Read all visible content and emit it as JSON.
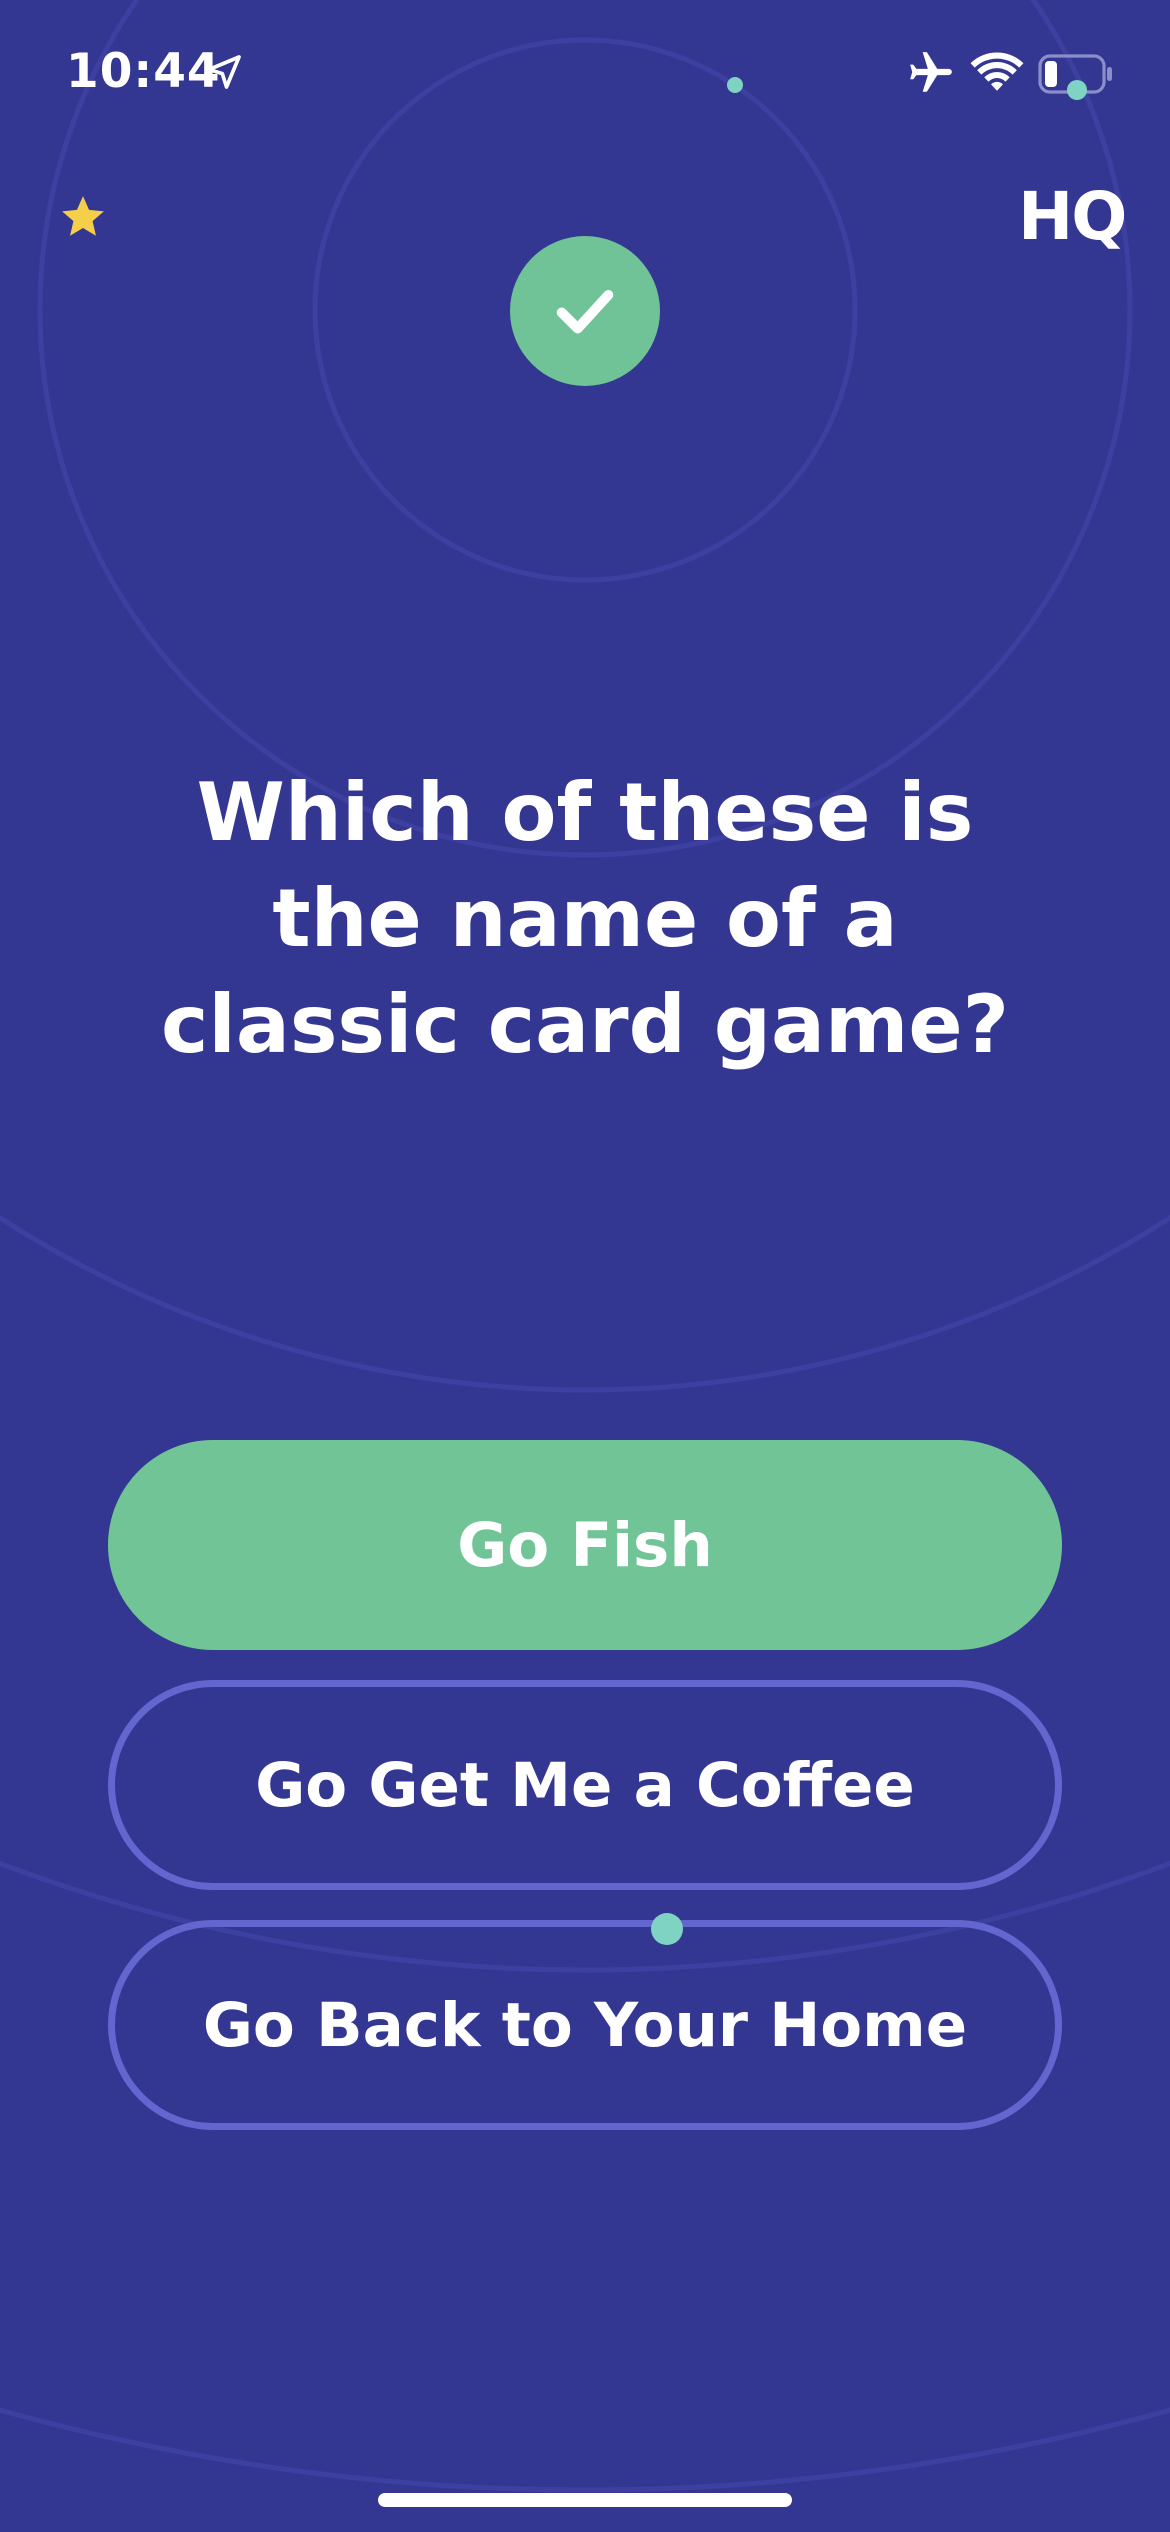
{
  "status_bar": {
    "time": "10:44",
    "location_icon": "location-arrow-icon",
    "airplane_icon": "airplane-icon",
    "wifi_icon": "wifi-icon",
    "battery_icon": "battery-icon"
  },
  "header": {
    "star_icon": "star-icon",
    "logo": "HQ"
  },
  "result": {
    "icon": "checkmark-icon",
    "color": "#6fc396"
  },
  "question": {
    "text": "Which of these is the name of a classic card game?"
  },
  "answers": [
    {
      "label": "Go Fish",
      "state": "correct"
    },
    {
      "label": "Go Get Me a Coffee",
      "state": "default"
    },
    {
      "label": "Go Back to Your Home",
      "state": "default"
    }
  ],
  "colors": {
    "background": "#343792",
    "correct": "#71c496",
    "outline": "#6366cf",
    "star": "#f6cf4a",
    "dot": "#7fd3c3"
  }
}
